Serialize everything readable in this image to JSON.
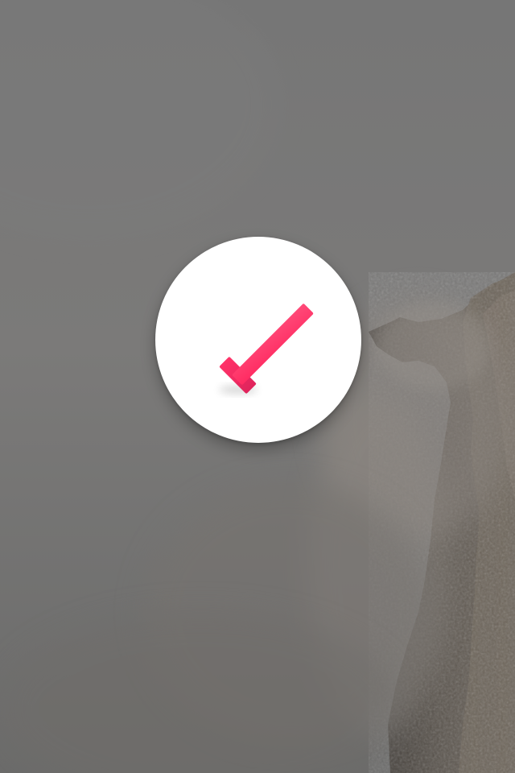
{
  "screen": {
    "background": "foggy-cliff-photo",
    "sky_color": "#7a7a7a",
    "rock_color": "#4f4a44"
  },
  "badge": {
    "icon": "checkmark-icon",
    "state": "success",
    "accent_color": "#ff2f68",
    "circle_color": "#ffffff"
  }
}
